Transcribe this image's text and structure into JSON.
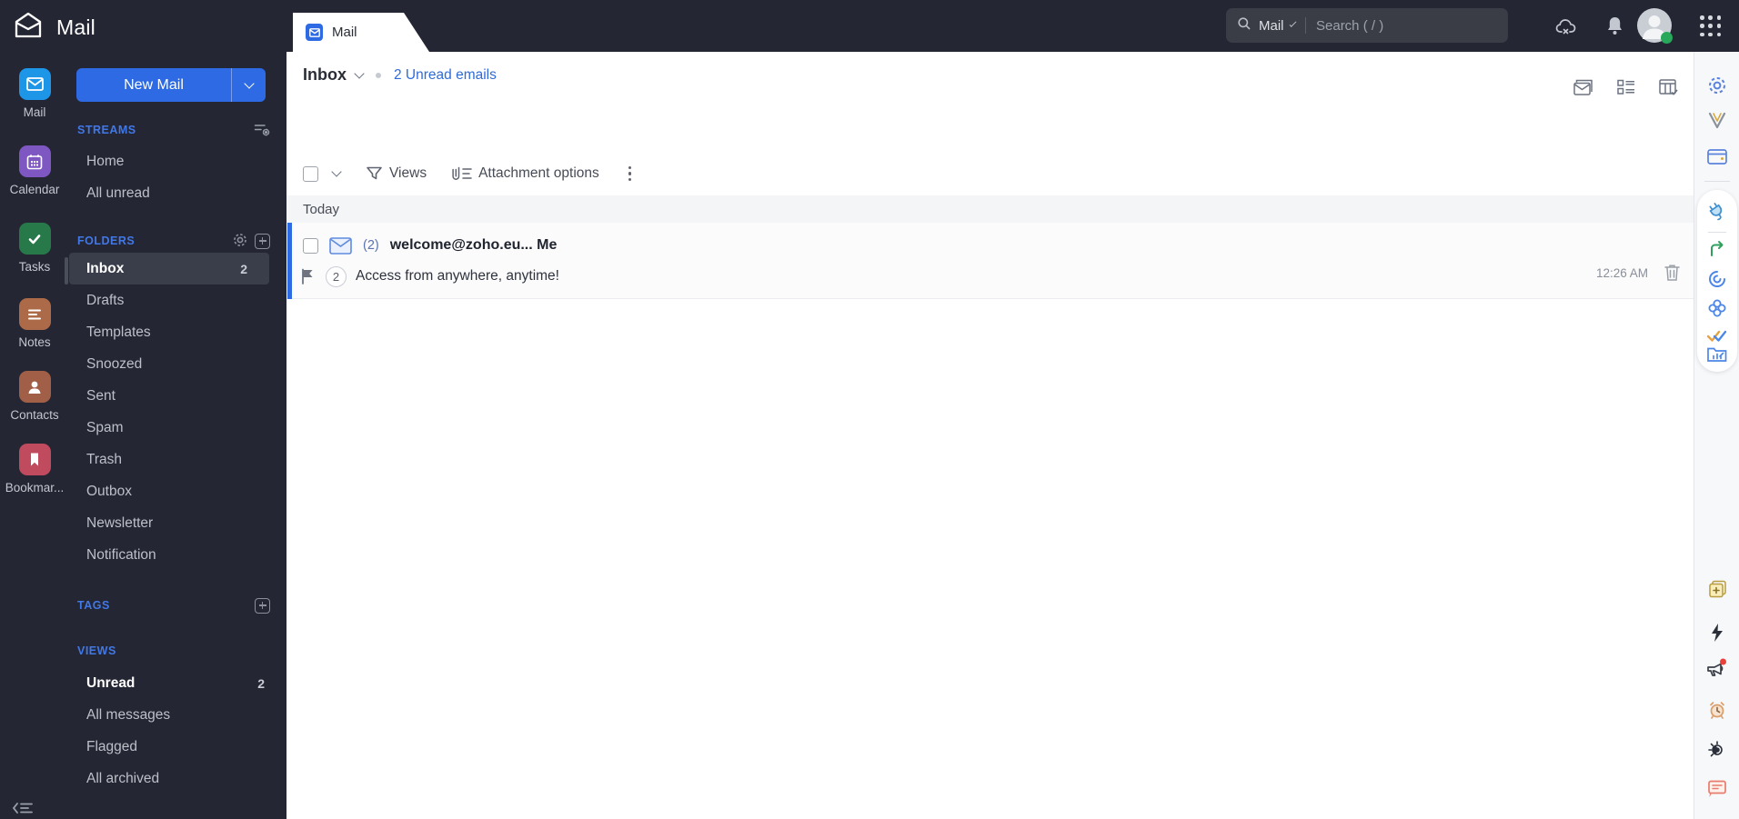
{
  "colors": {
    "header_bg": "#242633",
    "accent_blue": "#2D6AE3",
    "link_blue": "#2F6BD8",
    "section_header_blue": "#4178E8",
    "selected_row_bg": "#3A3E4B",
    "unread_accent": "#2D6AE3",
    "today_bar_bg": "#F4F5F6",
    "rail_mail": "#1D96E8",
    "rail_calendar": "#7E57C2",
    "rail_tasks": "#27794A",
    "rail_notes": "#AD6A49",
    "rail_contacts": "#A25F47",
    "rail_bookmarks": "#C04A5E",
    "status_online": "#27A85B",
    "notification_dot": "#E8403A"
  },
  "header": {
    "logo_title": "Mail",
    "search_scope": "Mail",
    "search_placeholder": "Search ( / )"
  },
  "tab": {
    "label": "Mail"
  },
  "rail": {
    "items": [
      {
        "label": "Mail"
      },
      {
        "label": "Calendar"
      },
      {
        "label": "Tasks"
      },
      {
        "label": "Notes"
      },
      {
        "label": "Contacts"
      },
      {
        "label": "Bookmar..."
      }
    ]
  },
  "sidebar": {
    "new_mail_label": "New Mail",
    "streams": {
      "title": "STREAMS",
      "items": [
        {
          "label": "Home"
        },
        {
          "label": "All unread"
        }
      ]
    },
    "folders": {
      "title": "FOLDERS",
      "items": [
        {
          "label": "Inbox",
          "count": "2"
        },
        {
          "label": "Drafts"
        },
        {
          "label": "Templates"
        },
        {
          "label": "Snoozed"
        },
        {
          "label": "Sent"
        },
        {
          "label": "Spam"
        },
        {
          "label": "Trash"
        },
        {
          "label": "Outbox"
        },
        {
          "label": "Newsletter"
        },
        {
          "label": "Notification"
        }
      ]
    },
    "tags": {
      "title": "TAGS"
    },
    "views": {
      "title": "VIEWS",
      "items": [
        {
          "label": "Unread",
          "count": "2"
        },
        {
          "label": "All messages"
        },
        {
          "label": "Flagged"
        },
        {
          "label": "All archived"
        }
      ]
    }
  },
  "list_header": {
    "folder": "Inbox",
    "unread_link": "2 Unread emails"
  },
  "toolbar": {
    "views_label": "Views",
    "attachment_label": "Attachment options"
  },
  "mail_list": {
    "group_label": "Today",
    "emails": [
      {
        "unread_count": "(2)",
        "sender": "welcome@zoho.eu... Me",
        "thread_count": "2",
        "subject": "Access from anywhere, anytime!",
        "time": "12:26 AM"
      }
    ]
  }
}
